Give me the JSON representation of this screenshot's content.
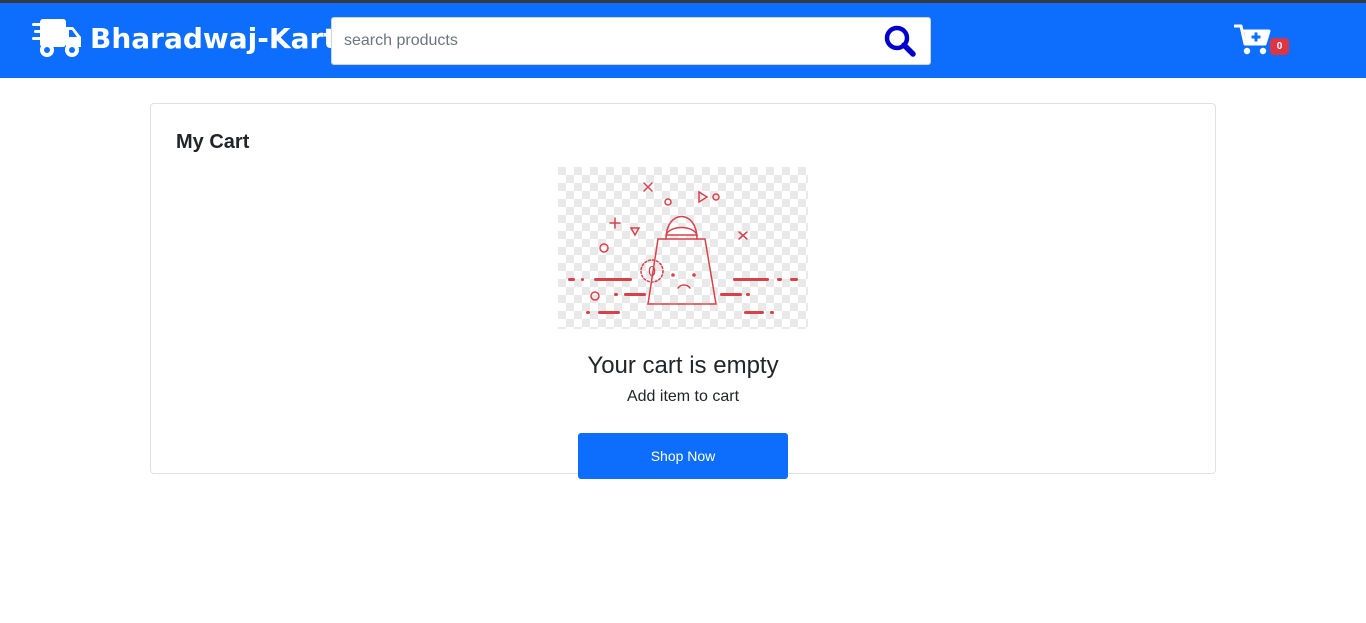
{
  "navbar": {
    "brand_name": "Bharadwaj-Kart",
    "brand_icon": "shipping-fast-truck-icon",
    "search": {
      "placeholder": "search products",
      "value": "",
      "icon": "search-icon"
    },
    "cart": {
      "icon": "cart-plus-icon",
      "count": "0"
    },
    "colors": {
      "navbar_bg": "#0d6efd",
      "search_icon": "#0000cc",
      "badge": "#dc3545"
    }
  },
  "cart_page": {
    "title": "My Cart",
    "illustration": "empty-shopping-bag-illustration",
    "empty_title": "Your cart is empty",
    "empty_subtitle": "Add item to cart",
    "shop_button": "Shop Now",
    "colors": {
      "accent": "#0d6efd",
      "illustration": "#d9414a"
    }
  }
}
